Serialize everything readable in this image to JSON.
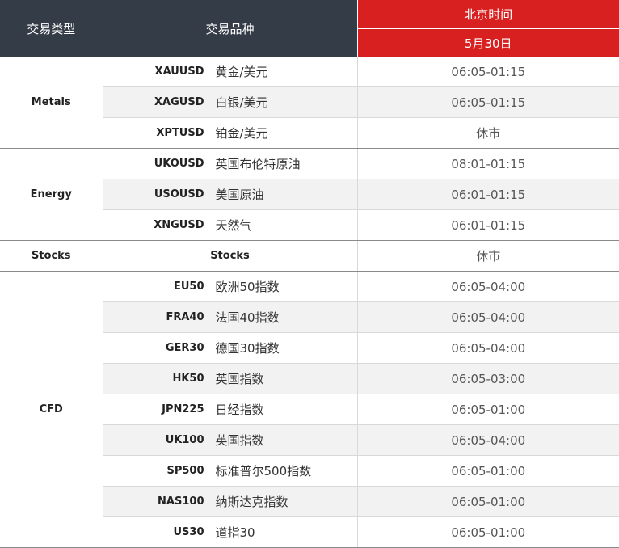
{
  "header": {
    "col_type": "交易类型",
    "col_product": "交易品种",
    "col_time": "北京时间",
    "date": "5月30日"
  },
  "groups": [
    {
      "category": "Metals",
      "rows": [
        {
          "code": "XAUUSD",
          "name": "黄金/美元",
          "time": "06:05-01:15"
        },
        {
          "code": "XAGUSD",
          "name": "白银/美元",
          "time": "06:05-01:15"
        },
        {
          "code": "XPTUSD",
          "name": "铂金/美元",
          "time": "休市"
        }
      ]
    },
    {
      "category": "Energy",
      "rows": [
        {
          "code": "UKOUSD",
          "name": "英国布伦特原油",
          "time": "08:01-01:15"
        },
        {
          "code": "USOUSD",
          "name": "美国原油",
          "time": "06:01-01:15"
        },
        {
          "code": "XNGUSD",
          "name": "天然气",
          "time": "06:01-01:15"
        }
      ]
    },
    {
      "category": "Stocks",
      "rows": [
        {
          "code": "Stocks",
          "name": "",
          "time": "休市"
        }
      ]
    },
    {
      "category": "CFD",
      "rows": [
        {
          "code": "EU50",
          "name": "欧洲50指数",
          "time": "06:05-04:00"
        },
        {
          "code": "FRA40",
          "name": "法国40指数",
          "time": "06:05-04:00"
        },
        {
          "code": "GER30",
          "name": "德国30指数",
          "time": "06:05-04:00"
        },
        {
          "code": "HK50",
          "name": "英国指数",
          "time": "06:05-03:00"
        },
        {
          "code": "JPN225",
          "name": "日经指数",
          "time": "06:05-01:00"
        },
        {
          "code": "UK100",
          "name": "英国指数",
          "time": "06:05-04:00"
        },
        {
          "code": "SP500",
          "name": "标准普尔500指数",
          "time": "06:05-01:00"
        },
        {
          "code": "NAS100",
          "name": "纳斯达克指数",
          "time": "06:05-01:00"
        },
        {
          "code": "US30",
          "name": "道指30",
          "time": "06:05-01:00"
        }
      ]
    }
  ],
  "colors": {
    "header_dark": "#343c47",
    "header_red": "#d7201f",
    "row_shade": "#f2f2f2"
  }
}
